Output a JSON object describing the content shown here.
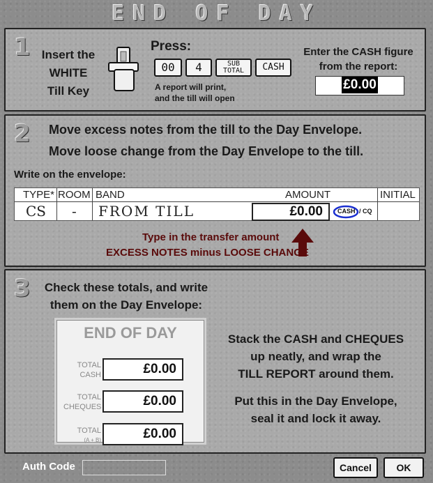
{
  "title": "END OF DAY",
  "step1": {
    "number": "1",
    "insert_line1": "Insert the",
    "insert_line2": "WHITE",
    "insert_line3": "Till Key",
    "press_label": "Press:",
    "keys": [
      "00",
      "4",
      "SUB TOTAL",
      "CASH"
    ],
    "report_line1": "A report will print,",
    "report_line2": "and the till will open",
    "cash_prompt_line1": "Enter the CASH figure",
    "cash_prompt_line2": "from the report:",
    "cash_value": "£0.00"
  },
  "step2": {
    "number": "2",
    "line1": "Move excess notes from the till to the Day Envelope.",
    "line2": "Move loose change from the Day Envelope to the till.",
    "write_label": "Write on the envelope:",
    "headers": {
      "type": "TYPE*",
      "room": "ROOM",
      "band": "BAND",
      "amount": "AMOUNT",
      "initial": "INITIAL"
    },
    "row": {
      "type": "CS",
      "room": "-",
      "band": "FROM TILL",
      "amount": "£0.00",
      "cash_mark": "CASH",
      "cq_mark": "/ CQ"
    },
    "hint_line1": "Type in the transfer amount",
    "hint_line2": "EXCESS NOTES minus LOOSE CHANGE"
  },
  "step3": {
    "number": "3",
    "line1": "Check these totals, and write",
    "line2": "them on the Day Envelope:",
    "card_title": "END OF DAY",
    "totals": [
      {
        "label1": "TOTAL",
        "label2": "CASH",
        "value": "£0.00"
      },
      {
        "label1": "TOTAL",
        "label2": "CHEQUES",
        "value": "£0.00"
      },
      {
        "label1": "TOTAL",
        "label2": "(A + B)",
        "value": "£0.00"
      }
    ],
    "instr_line1": "Stack the CASH and CHEQUES",
    "instr_line2": "up neatly, and wrap the",
    "instr_line3": "TILL REPORT around them.",
    "instr_line4": "Put this in the Day Envelope,",
    "instr_line5": "seal it and lock it away."
  },
  "footer": {
    "auth_label": "Auth Code",
    "auth_value": "",
    "cancel_label": "Cancel",
    "ok_label": "OK"
  }
}
